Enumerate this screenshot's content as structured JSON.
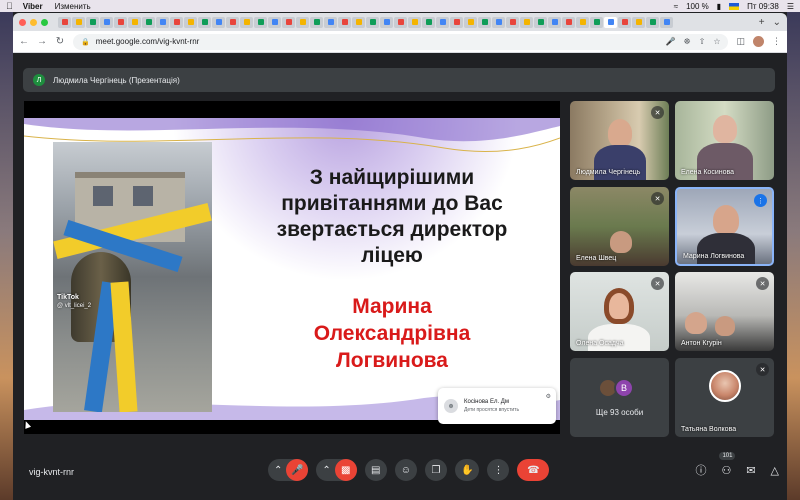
{
  "menubar": {
    "app_name": "Viber",
    "menu_edit": "Изменить",
    "battery": "100 %",
    "clock": "Пт 09:38"
  },
  "browser": {
    "url": "meet.google.com/vig-kvnt-rnr",
    "tab_colors": [
      "#e8453c",
      "#f4b400",
      "#0f9d58",
      "#4285f4",
      "#e8453c",
      "#f4b400",
      "#0f9d58",
      "#4285f4",
      "#e8453c",
      "#f4b400",
      "#0f9d58",
      "#4285f4",
      "#e8453c",
      "#f4b400",
      "#0f9d58",
      "#4285f4",
      "#e8453c",
      "#f4b400",
      "#0f9d58",
      "#4285f4",
      "#e8453c",
      "#f4b400",
      "#0f9d58",
      "#4285f4",
      "#e8453c",
      "#f4b400",
      "#0f9d58",
      "#4285f4",
      "#e8453c",
      "#f4b400",
      "#0f9d58",
      "#4285f4",
      "#e8453c",
      "#f4b400",
      "#0f9d58",
      "#4285f4",
      "#e8453c",
      "#f4b400",
      "#0f9d58",
      "#4285f4",
      "#e8453c",
      "#f4b400",
      "#0f9d58",
      "#4285f4"
    ]
  },
  "meet": {
    "presenter_initial": "Л",
    "presenter_label": "Людмила Чергінець (Презентація)",
    "slide": {
      "tiktok_logo": "TikTok",
      "tiktok_handle": "@ vlt_licei_2",
      "greeting_lines": [
        "З найщирішими",
        "привітаннями до Вас",
        "звертається директор",
        "ліцею"
      ],
      "name_lines": [
        "Марина",
        "Олександрівна",
        "Логвинова"
      ]
    },
    "toast": {
      "name": "Косінова Ел. Дм",
      "subtitle": "Дети просятся впустить"
    },
    "participants": [
      {
        "name": "Людмила Чергінець",
        "muted": true
      },
      {
        "name": "Елена Косинова",
        "muted": false
      },
      {
        "name": "Елена Швец",
        "muted": true
      },
      {
        "name": "Марина Логвинова",
        "speaking": true
      },
      {
        "name": "Олена Осадча",
        "muted": true
      },
      {
        "name": "Антон Кгурін",
        "muted": true
      }
    ],
    "more": {
      "initial": "В",
      "label": "Ще 93 особи"
    },
    "last_participant": {
      "name": "Татьяна Волкова",
      "muted": true
    },
    "meeting_code": "vig-kvnt-rnr",
    "participants_count": "101"
  }
}
